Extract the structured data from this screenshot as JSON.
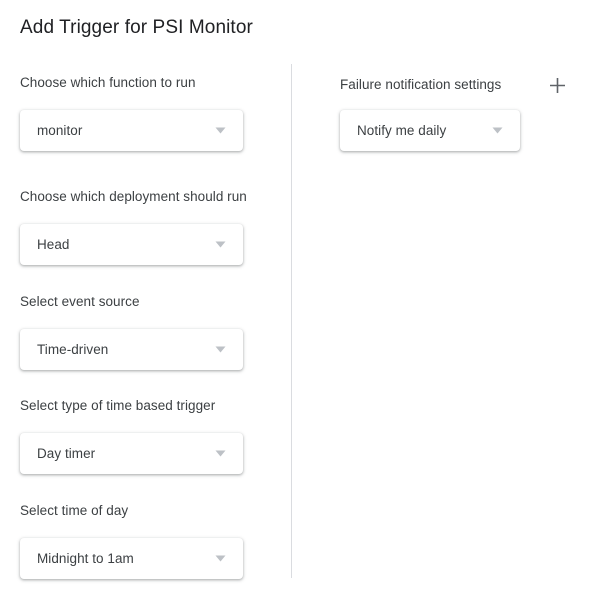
{
  "dialog": {
    "title": "Add Trigger for PSI Monitor"
  },
  "left_column": {
    "fields": [
      {
        "label": "Choose which function to run",
        "value": "monitor",
        "name": "function-select",
        "icon": "chevron-down-icon"
      },
      {
        "label": "Choose which deployment should run",
        "value": "Head",
        "name": "deployment-select",
        "icon": "chevron-down-icon"
      },
      {
        "label": "Select event source",
        "value": "Time-driven",
        "name": "event-source-select",
        "icon": "chevron-down-icon"
      },
      {
        "label": "Select type of time based trigger",
        "value": "Day timer",
        "name": "time-trigger-type-select",
        "icon": "chevron-down-icon"
      },
      {
        "label": "Select time of day",
        "value": "Midnight to 1am",
        "name": "time-of-day-select",
        "icon": "chevron-down-icon"
      }
    ]
  },
  "right_column": {
    "title": "Failure notification settings",
    "add_icon": "plus-icon",
    "notification": {
      "value": "Notify me daily",
      "name": "failure-notification-select",
      "icon": "chevron-down-icon"
    }
  },
  "colors": {
    "background": "#ffffff",
    "title_text": "#202124",
    "label_text": "#3c4043",
    "divider": "#dadce0",
    "icon_gray": "#9aa0a6",
    "plus_gray": "#5f6368"
  }
}
